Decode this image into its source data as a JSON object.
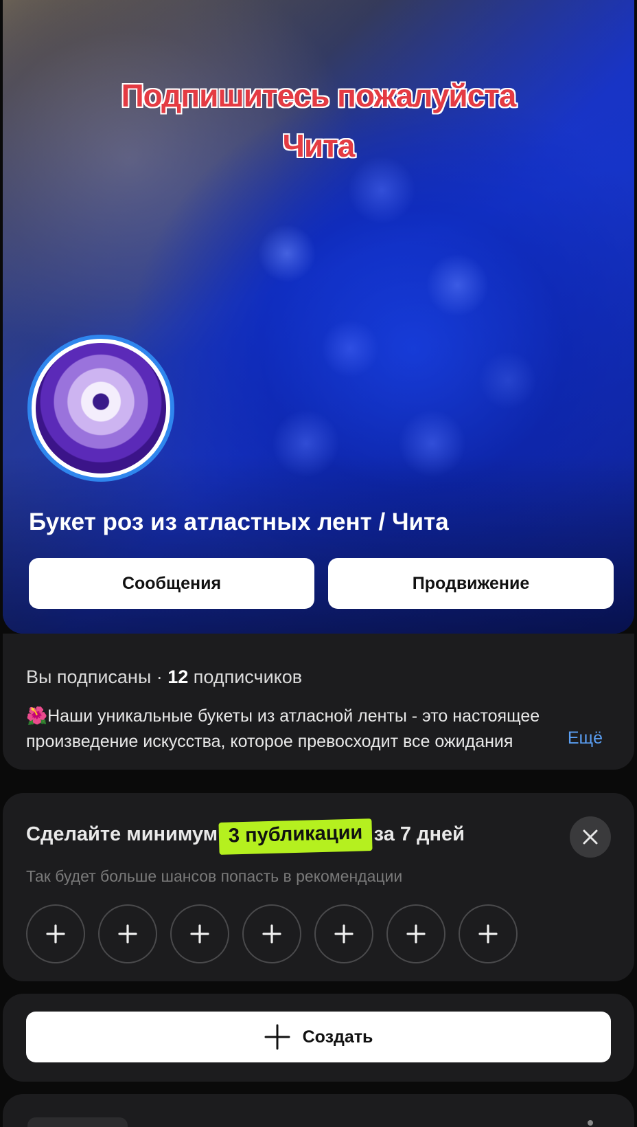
{
  "cover": {
    "overlay_line1": "Подпишитесь пожалуйста",
    "overlay_line2": "Чита",
    "title": "Букет роз из атластных лент / Чита",
    "messages_label": "Сообщения",
    "promotion_label": "Продвижение"
  },
  "info": {
    "subscribed_text": "Вы подписаны · ",
    "subscriber_count": "12",
    "subscribers_word": " подписчиков",
    "description_line1": "🌺Наши уникальные букеты из атласной ленты - это настоящее",
    "description_line2": "произведение искусства, которое превосходит все ожидания",
    "more_label": "Ещё"
  },
  "challenge": {
    "title_before": "Сделайте минимум ",
    "title_highlight": "3 публикации",
    "title_after": " за 7 дней",
    "subtitle": "Так будет больше шансов попасть в рекомендации",
    "highlight_color": "#b5f01f",
    "slots": [
      "+",
      "+",
      "+",
      "+",
      "+",
      "+",
      "+"
    ]
  },
  "create": {
    "label": "Создать"
  },
  "colors": {
    "accent_blue": "#2f86ee",
    "link_blue": "#5a9ef2",
    "card_bg": "#1c1c1e",
    "overlay_red": "#e43b43"
  }
}
